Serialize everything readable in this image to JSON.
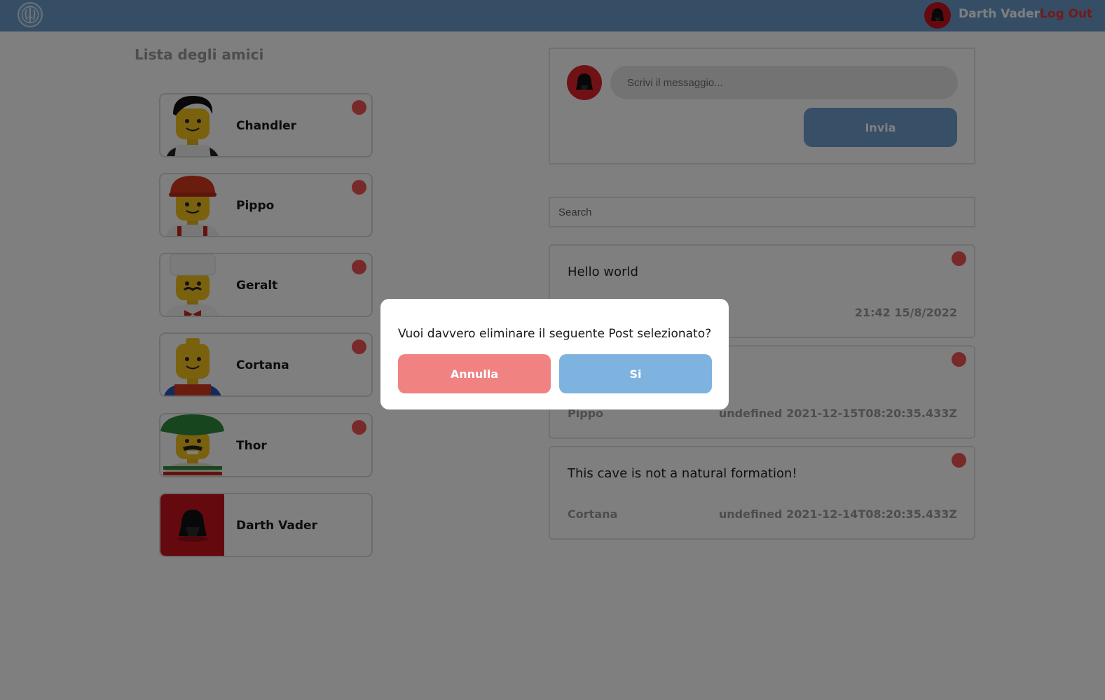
{
  "navbar": {
    "logo_icon": "jedi-order-logo-icon",
    "user_avatar_icon": "darth-vader-helmet-icon",
    "username": "Darth Vader",
    "logout_label": "Log Out",
    "colors": {
      "bar": "#6b9ccc",
      "logout": "#e63434"
    }
  },
  "friends": {
    "title": "Lista degli amici",
    "items": [
      {
        "name": "Chandler",
        "avatar": "lego-minifig-black-hair",
        "status": "online"
      },
      {
        "name": "Pippo",
        "avatar": "lego-minifig-red-hardhat",
        "status": "online"
      },
      {
        "name": "Geralt",
        "avatar": "lego-minifig-chef-hat",
        "status": "online"
      },
      {
        "name": "Cortana",
        "avatar": "lego-minifig-classic",
        "status": "online"
      },
      {
        "name": "Thor",
        "avatar": "lego-minifig-sombrero",
        "status": "online"
      },
      {
        "name": "Darth Vader",
        "avatar": "lego-darth-vader",
        "status": "self"
      }
    ]
  },
  "composer": {
    "avatar_icon": "darth-vader-helmet-icon",
    "placeholder": "Scrivi il messaggio...",
    "send_label": "Invia"
  },
  "search": {
    "placeholder": "Search"
  },
  "posts": [
    {
      "text": "Hello world",
      "author": "",
      "date": "21:42 15/8/2022"
    },
    {
      "text": "",
      "author": "Pippo",
      "date": "undefined 2021-12-15T08:20:35.433Z"
    },
    {
      "text": "This cave is not a natural formation!",
      "author": "Cortana",
      "date": "undefined 2021-12-14T08:20:35.433Z"
    }
  ],
  "modal": {
    "question": "Vuoi davvero eliminare il seguente Post selezionato?",
    "cancel_label": "Annulla",
    "confirm_label": "Si"
  }
}
